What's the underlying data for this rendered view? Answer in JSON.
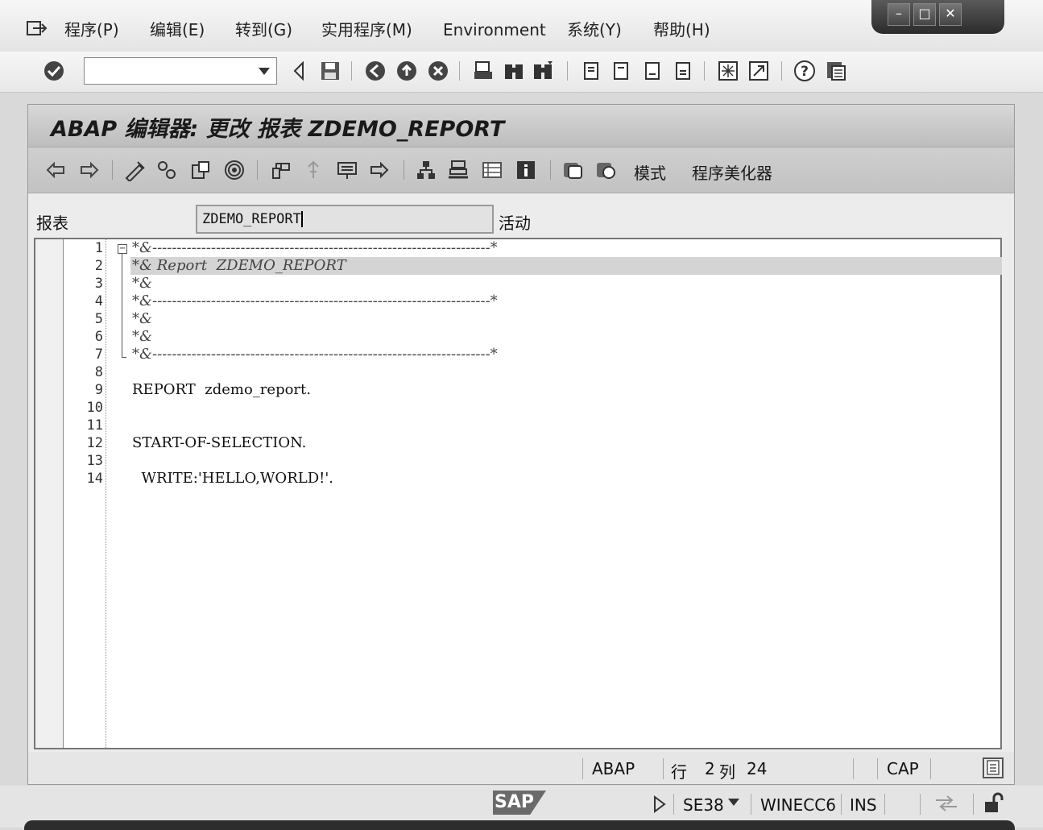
{
  "menu": {
    "items": [
      "程序(P)",
      "编辑(E)",
      "转到(G)",
      "实用程序(M)",
      "Environment",
      "系统(Y)",
      "帮助(H)"
    ]
  },
  "toolbar": {
    "command_field_value": ""
  },
  "window": {
    "title": "ABAP 编辑器: 更改 报表 ZDEMO_REPORT"
  },
  "app_toolbar": {
    "mode_label": "模式",
    "pretty_printer_label": "程序美化器"
  },
  "report": {
    "label": "报表",
    "value": "ZDEMO_REPORT",
    "status": "活动"
  },
  "editor": {
    "lines": [
      {
        "num": "1",
        "text": "*&---------------------------------------------------------------------*",
        "comment": true
      },
      {
        "num": "2",
        "text": "*& Report  ZDEMO_REPORT",
        "comment": true
      },
      {
        "num": "3",
        "text": "*&",
        "comment": true
      },
      {
        "num": "4",
        "text": "*&---------------------------------------------------------------------*",
        "comment": true
      },
      {
        "num": "5",
        "text": "*&",
        "comment": true
      },
      {
        "num": "6",
        "text": "*&",
        "comment": true
      },
      {
        "num": "7",
        "text": "*&---------------------------------------------------------------------*",
        "comment": true
      },
      {
        "num": "8",
        "text": "",
        "comment": false
      },
      {
        "num": "9",
        "text": "REPORT  zdemo_report.",
        "comment": false
      },
      {
        "num": "10",
        "text": "",
        "comment": false
      },
      {
        "num": "11",
        "text": "",
        "comment": false
      },
      {
        "num": "12",
        "text": "START-OF-SELECTION.",
        "comment": false
      },
      {
        "num": "13",
        "text": "",
        "comment": false
      },
      {
        "num": "14",
        "text": "  WRITE:'HELLO,WORLD!'.",
        "comment": false
      }
    ]
  },
  "editor_status": {
    "language": "ABAP",
    "row_label": "行",
    "row": "2",
    "col_label": "列",
    "col": "24",
    "caps": "CAP"
  },
  "status_bar": {
    "logo": "SAP",
    "transaction": "SE38",
    "system": "WINECC6",
    "mode": "INS"
  }
}
